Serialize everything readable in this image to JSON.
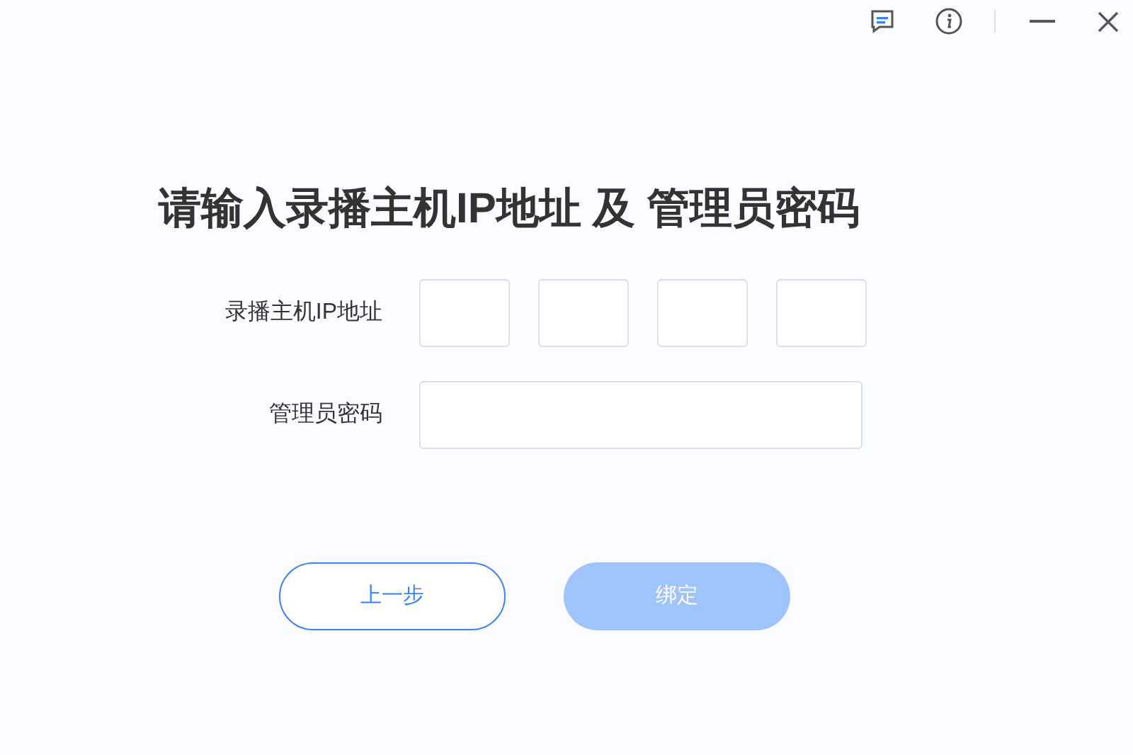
{
  "title": "请输入录播主机IP地址 及 管理员密码",
  "ip_field": {
    "label": "录播主机IP地址"
  },
  "password_field": {
    "label": "管理员密码"
  },
  "buttons": [
    {
      "label": "上一步",
      "kind": "outline",
      "disabled": false
    },
    {
      "label": "绑定",
      "kind": "primary",
      "disabled": true
    }
  ]
}
